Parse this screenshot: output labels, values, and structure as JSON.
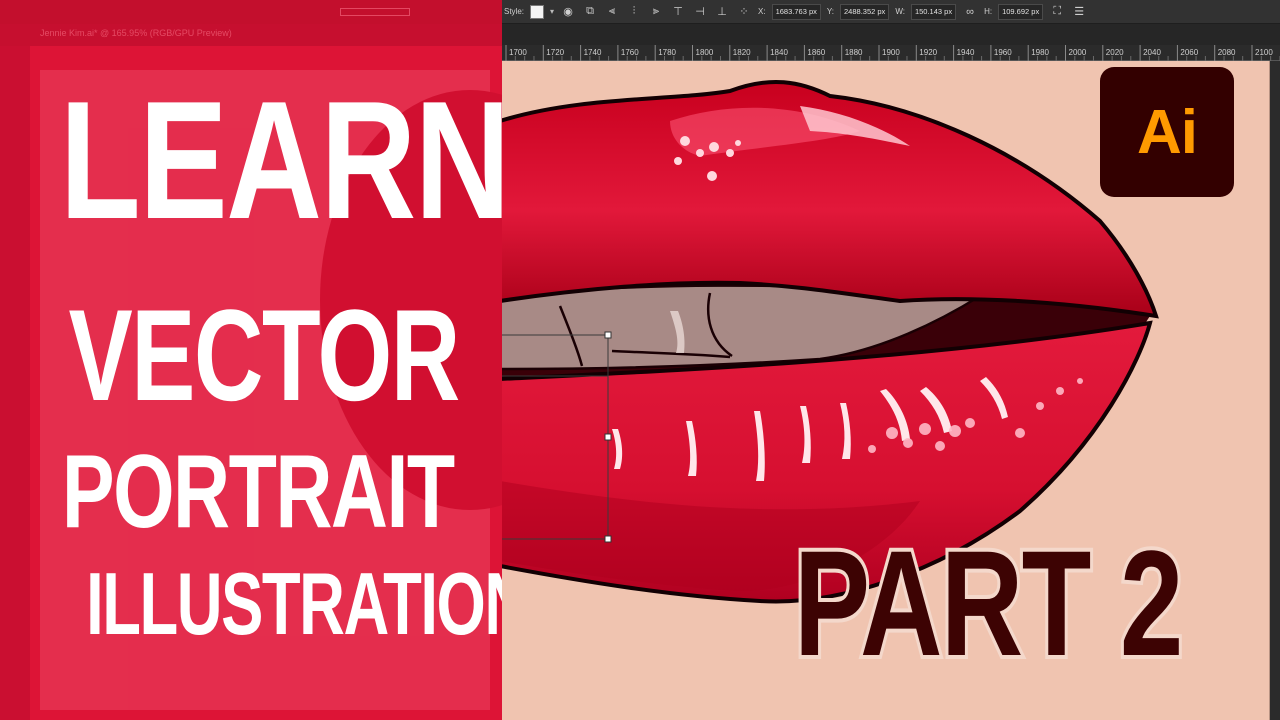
{
  "headline": {
    "line1": "LEARN",
    "line2": "VECTOR",
    "line3": "PORTRAIT",
    "line4": "ILLUSTRATION"
  },
  "badge": {
    "text": "Ai"
  },
  "part_label": "PART 2",
  "control_bar": {
    "style_label": "Style:",
    "x_label": "X:",
    "x_value": "1683.763 px",
    "y_label": "Y:",
    "y_value": "2488.352 px",
    "w_label": "W:",
    "w_value": "150.143 px",
    "h_label": "H:",
    "h_value": "109.692 px"
  },
  "ruler": {
    "ticks": [
      "1700",
      "1720",
      "1740",
      "1760",
      "1780",
      "1800",
      "1820",
      "1840",
      "1860",
      "1880",
      "1900",
      "1920",
      "1940",
      "1960",
      "1980",
      "2000",
      "2020",
      "2040",
      "2060",
      "2080",
      "2100"
    ]
  },
  "ghost": {
    "document_tab": "Jennie Kim.ai* @ 165.95% (RGB/GPU Preview)"
  },
  "colors": {
    "left_panel": "#dd1436",
    "canvas": "#f0c4b0",
    "badge_bg": "#330000",
    "badge_text": "#ff9a00",
    "part_text": "#3d0303",
    "lip_red": "#d9102e"
  }
}
